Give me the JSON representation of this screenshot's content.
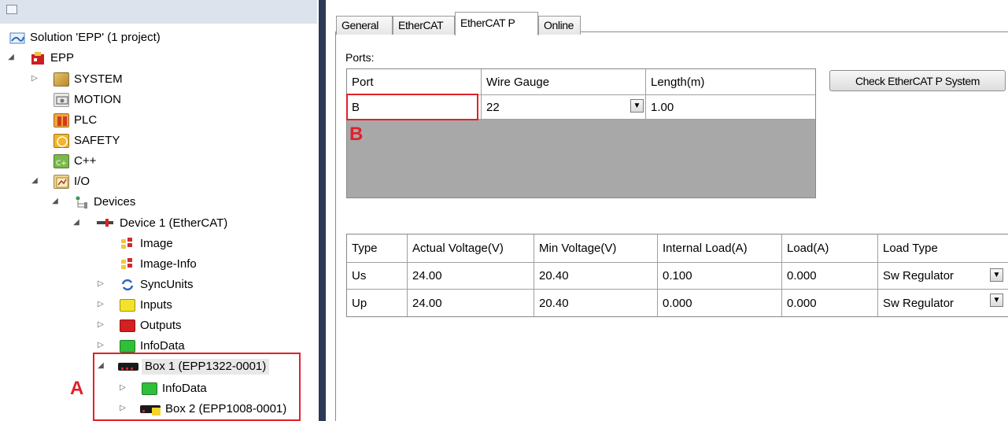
{
  "solution_tree": {
    "solution_label": "Solution 'EPP' (1 project)",
    "project_label": "EPP",
    "nodes": {
      "system": "SYSTEM",
      "motion": "MOTION",
      "plc": "PLC",
      "safety": "SAFETY",
      "cpp": "C++",
      "io": "I/O",
      "devices": "Devices",
      "device1": "Device 1 (EtherCAT)",
      "image": "Image",
      "image_info": "Image-Info",
      "sync_units": "SyncUnits",
      "inputs": "Inputs",
      "outputs": "Outputs",
      "info_data": "InfoData",
      "box1": "Box 1 (EPP1322-0001)",
      "box1_info_data": "InfoData",
      "box2": "Box 2 (EPP1008-0001)"
    }
  },
  "tabs": [
    "General",
    "EtherCAT",
    "EtherCAT P",
    "Online"
  ],
  "active_tab": "EtherCAT P",
  "ports_label": "Ports:",
  "ports_table": {
    "headers": [
      "Port",
      "Wire Gauge",
      "Length(m)"
    ],
    "row": {
      "port": "B",
      "wire_gauge": "22",
      "length": "1.00"
    }
  },
  "check_button_label": "Check EtherCAT P System",
  "voltage_table": {
    "headers": [
      "Type",
      "Actual Voltage(V)",
      "Min Voltage(V)",
      "Internal Load(A)",
      "Load(A)",
      "Load Type"
    ],
    "rows": [
      [
        "Us",
        "24.00",
        "20.40",
        "0.100",
        "0.000",
        "Sw Regulator"
      ],
      [
        "Up",
        "24.00",
        "20.40",
        "0.000",
        "0.000",
        "Sw Regulator"
      ]
    ]
  },
  "annotations": {
    "a": "A",
    "b": "B"
  },
  "colors": {
    "annotation_red": "#e0212b",
    "splitter": "#2b3a55",
    "grid_empty": "#a8a8a8"
  }
}
